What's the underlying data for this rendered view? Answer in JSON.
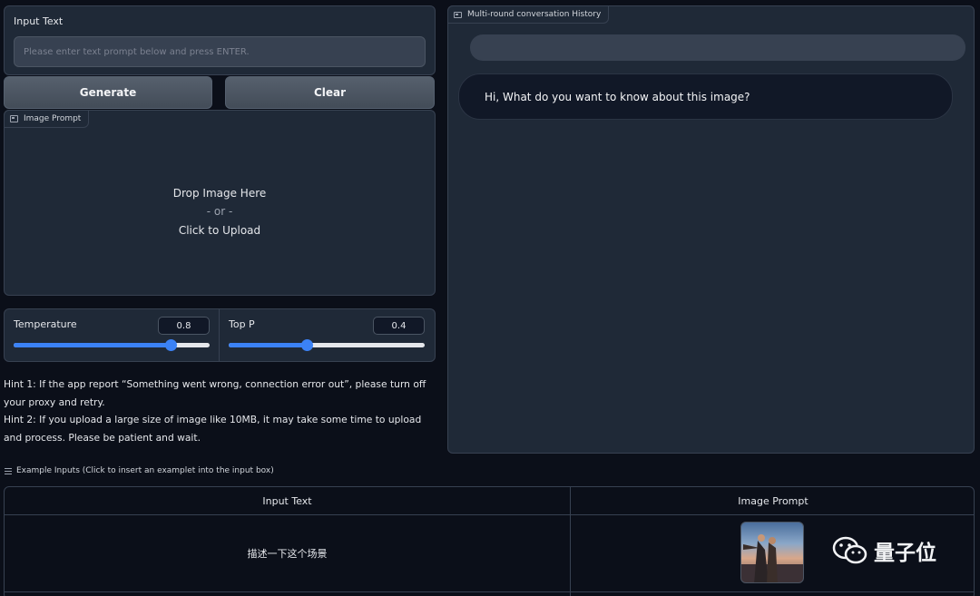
{
  "input": {
    "label": "Input Text",
    "placeholder": "Please enter text prompt below and press ENTER.",
    "value": ""
  },
  "buttons": {
    "generate": "Generate",
    "clear": "Clear"
  },
  "image_prompt": {
    "label": "Image Prompt",
    "drop_line1": "Drop Image Here",
    "drop_line2": "- or -",
    "drop_line3": "Click to Upload"
  },
  "sliders": {
    "temperature": {
      "label": "Temperature",
      "value": "0.8",
      "fraction": 0.8
    },
    "top_p": {
      "label": "Top P",
      "value": "0.4",
      "fraction": 0.4
    }
  },
  "hints": {
    "hint1": "Hint 1: If the app report “Something went wrong, connection error out”, please turn off your proxy and retry.",
    "hint2": "Hint 2: If you upload a large size of image like 10MB, it may take some time to upload and process. Please be patient and wait."
  },
  "chat": {
    "label": "Multi-round conversation History",
    "user_message": "",
    "bot_message": "Hi, What do you want to know about this image?"
  },
  "examples": {
    "label": "Example Inputs (Click to insert an examplet into the input box)",
    "headers": [
      "Input Text",
      "Image Prompt"
    ],
    "rows": [
      {
        "text": "描述一下这个场景"
      }
    ]
  },
  "watermark": {
    "text": "量子位"
  }
}
